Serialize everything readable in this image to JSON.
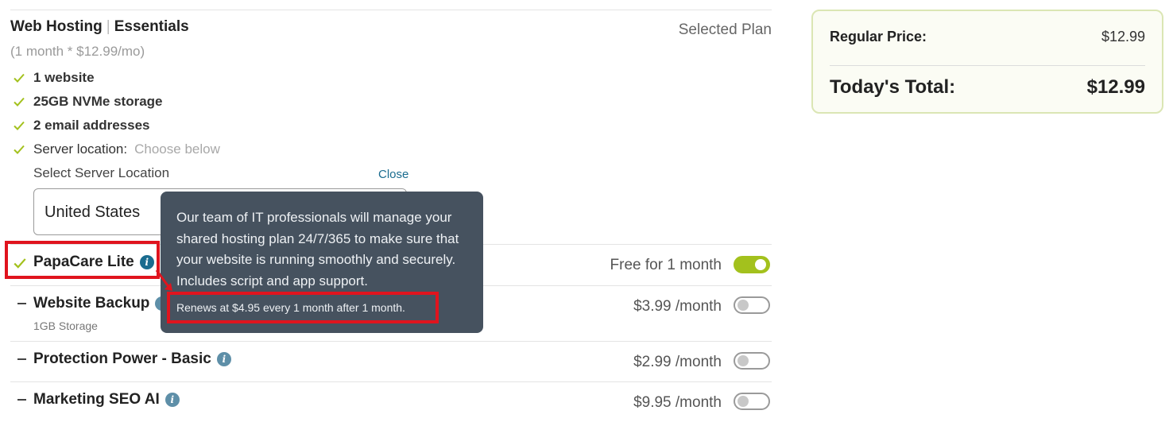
{
  "plan": {
    "category": "Web Hosting",
    "name": "Essentials",
    "selected_label": "Selected Plan",
    "subtitle": "(1 month * $12.99/mo)",
    "features": [
      {
        "text": "1 website"
      },
      {
        "text": "25GB NVMe storage"
      },
      {
        "text": "2 email addresses"
      }
    ],
    "server": {
      "label": "Server location:",
      "hint": "Choose below",
      "select_label": "Select Server Location",
      "close_label": "Close",
      "selected_value": "United States"
    }
  },
  "addons": [
    {
      "name": "PapaCare Lite",
      "price": "Free for 1 month",
      "enabled": true
    },
    {
      "name": "Website Backup",
      "sub": "1GB Storage",
      "price": "$3.99 /month",
      "enabled": false
    },
    {
      "name": "Protection Power - Basic",
      "price": "$2.99 /month",
      "enabled": false
    },
    {
      "name": "Marketing SEO AI",
      "price": "$9.95 /month",
      "enabled": false
    }
  ],
  "tooltip": {
    "text": "Our team of IT professionals will manage your shared hosting plan 24/7/365 to make sure that your website is running smoothly and securely. Includes script and app support.",
    "renewal": "Renews at $4.95 every 1 month after 1 month."
  },
  "summary": {
    "regular_label": "Regular Price:",
    "regular_value": "$12.99",
    "total_label": "Today's Total:",
    "total_value": "$12.99"
  },
  "colors": {
    "accent_green": "#a3c11d",
    "link_blue": "#1a6c8f",
    "highlight_red": "#e0141e",
    "tooltip_bg": "#46525f"
  }
}
